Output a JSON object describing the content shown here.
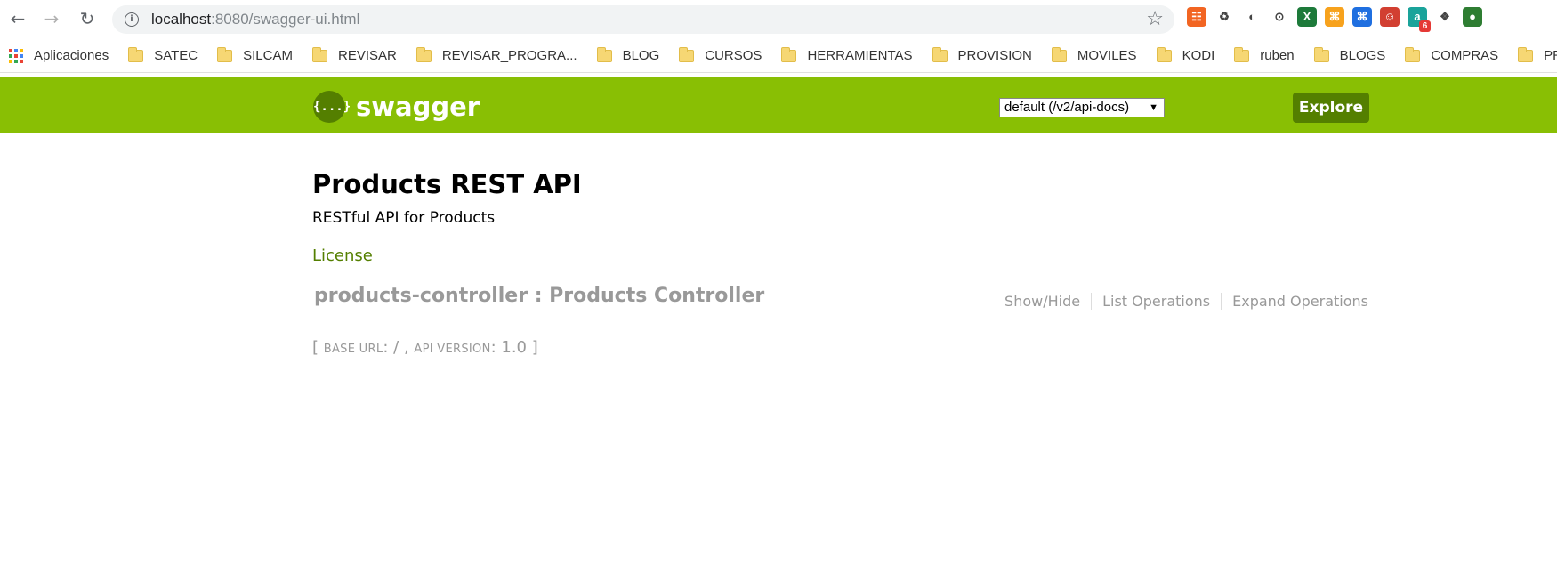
{
  "browser": {
    "url_host": "localhost",
    "url_rest": ":8080/swagger-ui.html",
    "extensions": [
      {
        "name": "rss-icon",
        "color": "#f26522",
        "glyph": "☷"
      },
      {
        "name": "recycle-icon",
        "color": "#ffffff",
        "glyph": "♻"
      },
      {
        "name": "circle-ext-icon",
        "color": "#ffffff",
        "glyph": "◐"
      },
      {
        "name": "code-ext-icon",
        "color": "#ffffff",
        "glyph": "⊙"
      },
      {
        "name": "excel-ext-icon",
        "color": "#1d7a3a",
        "glyph": "X"
      },
      {
        "name": "feed-icon",
        "color": "#f7a21d",
        "glyph": "⌘"
      },
      {
        "name": "wifi-feed-icon",
        "color": "#1f6fe0",
        "glyph": "⌘"
      },
      {
        "name": "avatar-ext-icon",
        "color": "#d23f31",
        "glyph": "☺"
      },
      {
        "name": "a-ext-icon",
        "color": "#1aa39a",
        "glyph": "a",
        "badge": "6"
      },
      {
        "name": "tag-ext-icon",
        "color": "#cccccc",
        "glyph": "❖"
      },
      {
        "name": "globe-ext-icon",
        "color": "#2e7d32",
        "glyph": "●"
      }
    ]
  },
  "bookmarks": {
    "apps_label": "Aplicaciones",
    "folders": [
      "SATEC",
      "SILCAM",
      "REVISAR",
      "REVISAR_PROGRA...",
      "BLOG",
      "CURSOS",
      "HERRAMIENTAS",
      "PROVISION",
      "MOVILES",
      "KODI",
      "ruben",
      "BLOGS",
      "COMPRAS",
      "PROGRAMACION"
    ]
  },
  "swagger": {
    "logo_glyph": "{...}",
    "logo_text": "swagger",
    "spec_select": "default (/v2/api-docs)",
    "explore_label": "Explore"
  },
  "api": {
    "title": "Products REST API",
    "description": "RESTful API for Products",
    "license_label": "License",
    "resource": {
      "title": "products-controller : Products Controller",
      "show_hide": "Show/Hide",
      "list_operations": "List Operations",
      "expand_operations": "Expand Operations"
    },
    "base": {
      "open": "[",
      "base_url_label": "base url",
      "base_url_value": ": / ,",
      "api_version_label": "api version",
      "api_version_value": ": 1.0",
      "close": "]"
    }
  }
}
